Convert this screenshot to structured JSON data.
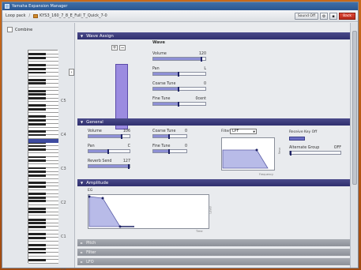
{
  "window": {
    "title": "Yamaha Expansion Manager"
  },
  "toolbar": {
    "breadcrumb_root": "Loop pack",
    "breadcrumb_file": "KYS3_160_7_8_E_Full_T_Quick_7-0",
    "sound_off_label": "Sound Off",
    "back_label": "Back"
  },
  "left_panel": {
    "combine_label": "Combine",
    "octaves": [
      "C5",
      "C4",
      "C3",
      "C2",
      "C1",
      "C0"
    ]
  },
  "wave_assign": {
    "header": "Wave Assign",
    "title": "Wave",
    "params": [
      {
        "label": "Volume",
        "value": "120",
        "level": 0.94
      },
      {
        "label": "Pan",
        "value": "L",
        "level": 0.5
      },
      {
        "label": "Coarse Tune",
        "value": "0",
        "level": 0.5
      },
      {
        "label": "Fine Tune",
        "value": "0cent",
        "level": 0.5
      }
    ]
  },
  "general": {
    "header": "General",
    "volume": {
      "label": "Volume",
      "value": "106",
      "level": 0.83
    },
    "pan": {
      "label": "Pan",
      "value": "C",
      "level": 0.5
    },
    "reverb_send": {
      "label": "Reverb Send",
      "value": "127",
      "level": 1.0
    },
    "coarse_tune": {
      "label": "Coarse Tune",
      "value": "0",
      "level": 0.5
    },
    "fine_tune": {
      "label": "Fine Tune",
      "value": "0",
      "level": 0.5
    },
    "filter_label": "Filter",
    "filter_type": "LPF",
    "frequency_label": "Frequency",
    "resonance_label": "Reso",
    "receive_key_off_label": "Receive Key Off",
    "alternate_group_label": "Alternate Group",
    "alternate_group_value": "OFF"
  },
  "amplitude": {
    "header": "Amplitude",
    "eg_label": "EG",
    "level_axis": "Level",
    "time_axis": "Time"
  },
  "collapsed_sections": [
    "Pitch",
    "Filter",
    "LFO"
  ],
  "colors": {
    "section": "#2f2f6e",
    "accent": "#8e90d6",
    "background": "#b35612"
  }
}
